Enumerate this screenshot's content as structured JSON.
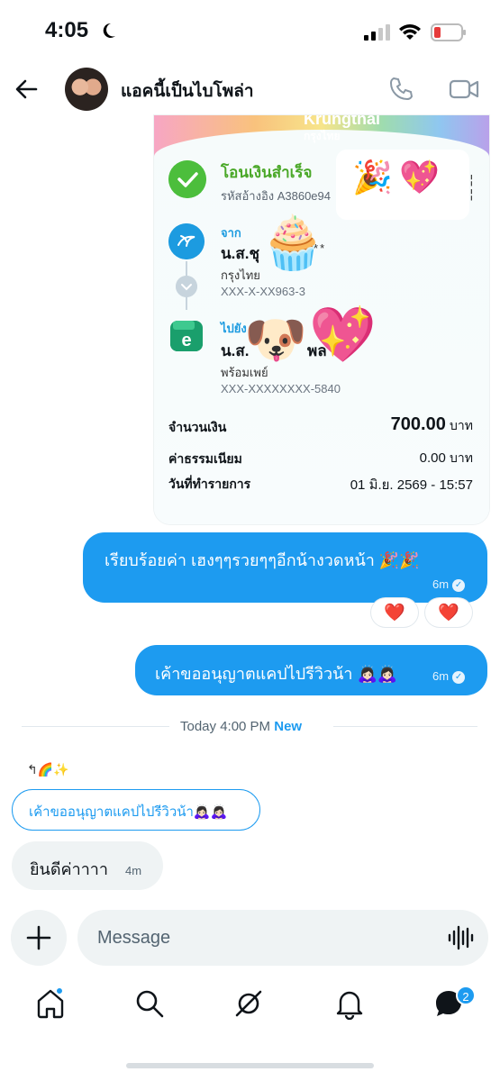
{
  "status_bar": {
    "time": "4:05"
  },
  "header": {
    "contact_name": "แอคนี้เป็นไบโพล่า"
  },
  "receipt": {
    "bank_name": "Krungthai",
    "bank_name_thai": "กรุงไทย",
    "status_title": "โอนเงินสำเร็จ",
    "reference": "รหัสอ้างอิง A3860e94",
    "from_label": "จาก",
    "from_name": "น.ส.ชุ",
    "from_masked": "***",
    "from_bank": "กรุงไทย",
    "from_account": "XXX-X-XX963-3",
    "to_label": "ไปยัง",
    "to_name_prefix": "น.ส.",
    "to_name_suffix": "พล",
    "to_service": "พร้อมเพย์",
    "to_account": "XXX-XXXXXXXX-5840",
    "amount_label": "จำนวนเงิน",
    "amount": "700.00",
    "amount_unit": "บาท",
    "fee_label": "ค่าธรรมเนียม",
    "fee": "0.00",
    "fee_unit": "บาท",
    "date_label": "วันที่ทำรายการ",
    "date": "01 มิ.ย. 2569 - 15:57",
    "stickers": [
      "🎉",
      "💖",
      "🧁",
      "🐶",
      "💖"
    ]
  },
  "messages": {
    "out1": {
      "text": "เรียบร้อยค่า เฮงๆๆรวยๆๆอีกน้างวดหน้า 🎉🎉",
      "time": "6m"
    },
    "reactions": [
      "❤️",
      "❤️"
    ],
    "out2": {
      "text": "เค้าขออนุญาตแคปไปรีวิวน้า 🙇🏻‍♀️🙇🏻‍♀️",
      "time": "6m"
    },
    "divider": {
      "label": "Today 4:00 PM",
      "new": "New"
    },
    "reply_indicator": "🌈✨",
    "quoted_text": "เค้าขออนุญาตแคปไปรีวิวน้า🙇🏻‍♀️🙇🏻‍♀️",
    "in1": {
      "text": "ยินดีค่าาาา",
      "time": "4m"
    }
  },
  "composer": {
    "placeholder": "Message"
  },
  "tabbar": {
    "messages_badge": "2"
  },
  "colors": {
    "accent": "#1d9bf0",
    "success": "#4cbe3c",
    "heart": "#e0245e"
  }
}
